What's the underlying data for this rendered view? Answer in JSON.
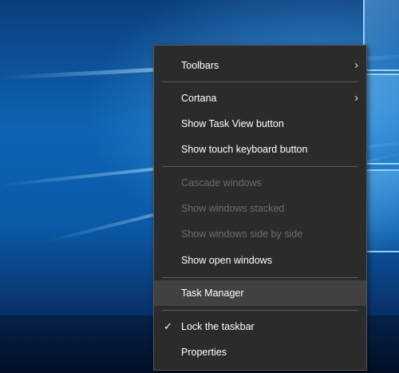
{
  "menu": {
    "items": [
      {
        "label": "Toolbars",
        "arrow": "›"
      },
      {
        "label": "Cortana",
        "arrow": "›"
      },
      {
        "label": "Show Task View button"
      },
      {
        "label": "Show touch keyboard button"
      },
      {
        "label": "Cascade windows"
      },
      {
        "label": "Show windows stacked"
      },
      {
        "label": "Show windows side by side"
      },
      {
        "label": "Show open windows"
      },
      {
        "label": "Task Manager"
      },
      {
        "label": "Lock the taskbar",
        "check": "✓"
      },
      {
        "label": "Properties"
      }
    ]
  },
  "colors": {
    "menu_bg": "#2b2b2b",
    "menu_text": "#ffffff",
    "disabled_text": "#6d6d6d",
    "highlight": "#414141"
  },
  "icons": {
    "submenu_arrow": "chevron-right-icon",
    "checkmark": "checkmark-icon"
  }
}
